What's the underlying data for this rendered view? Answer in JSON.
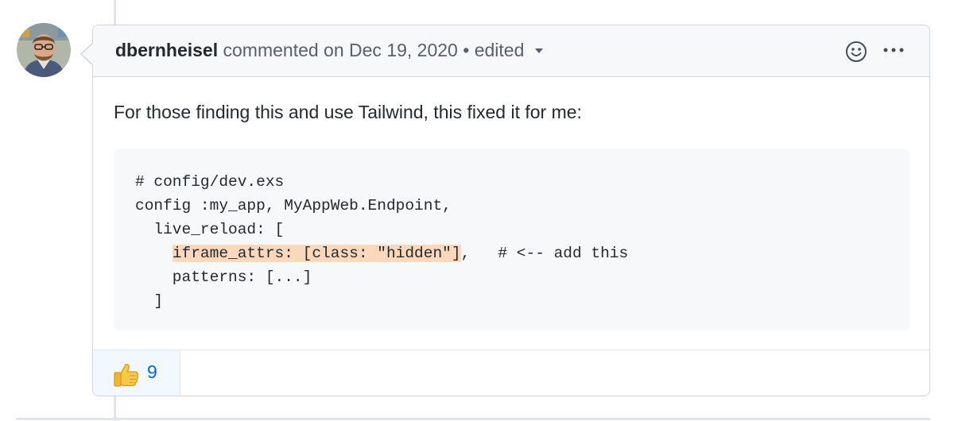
{
  "comment": {
    "author": "dbernheisel",
    "action": "commented on",
    "date": "Dec 19, 2020",
    "separator": "•",
    "edited_label": "edited",
    "body": "For those finding this and use Tailwind, this fixed it for me:",
    "code": {
      "line_1": "# config/dev.exs",
      "line_2": "config :my_app, MyAppWeb.Endpoint,",
      "line_3": "  live_reload: [",
      "line_4_indent": "    ",
      "line_4_highlight": "iframe_attrs: [class: \"hidden\"]",
      "line_4_rest": ",   # <-- add this",
      "line_5": "    patterns: [...]",
      "line_6": "  ]"
    },
    "reactions": [
      {
        "icon": "thumbs-up-icon",
        "count": "9"
      }
    ]
  },
  "colors": {
    "author": "#24292e",
    "meta": "#586069",
    "header_bg": "#f6f8fa",
    "border": "#d1d5da",
    "highlight": "#f9d8bc",
    "reaction_count": "#0366d6",
    "reaction_bg": "#f1f8ff"
  }
}
